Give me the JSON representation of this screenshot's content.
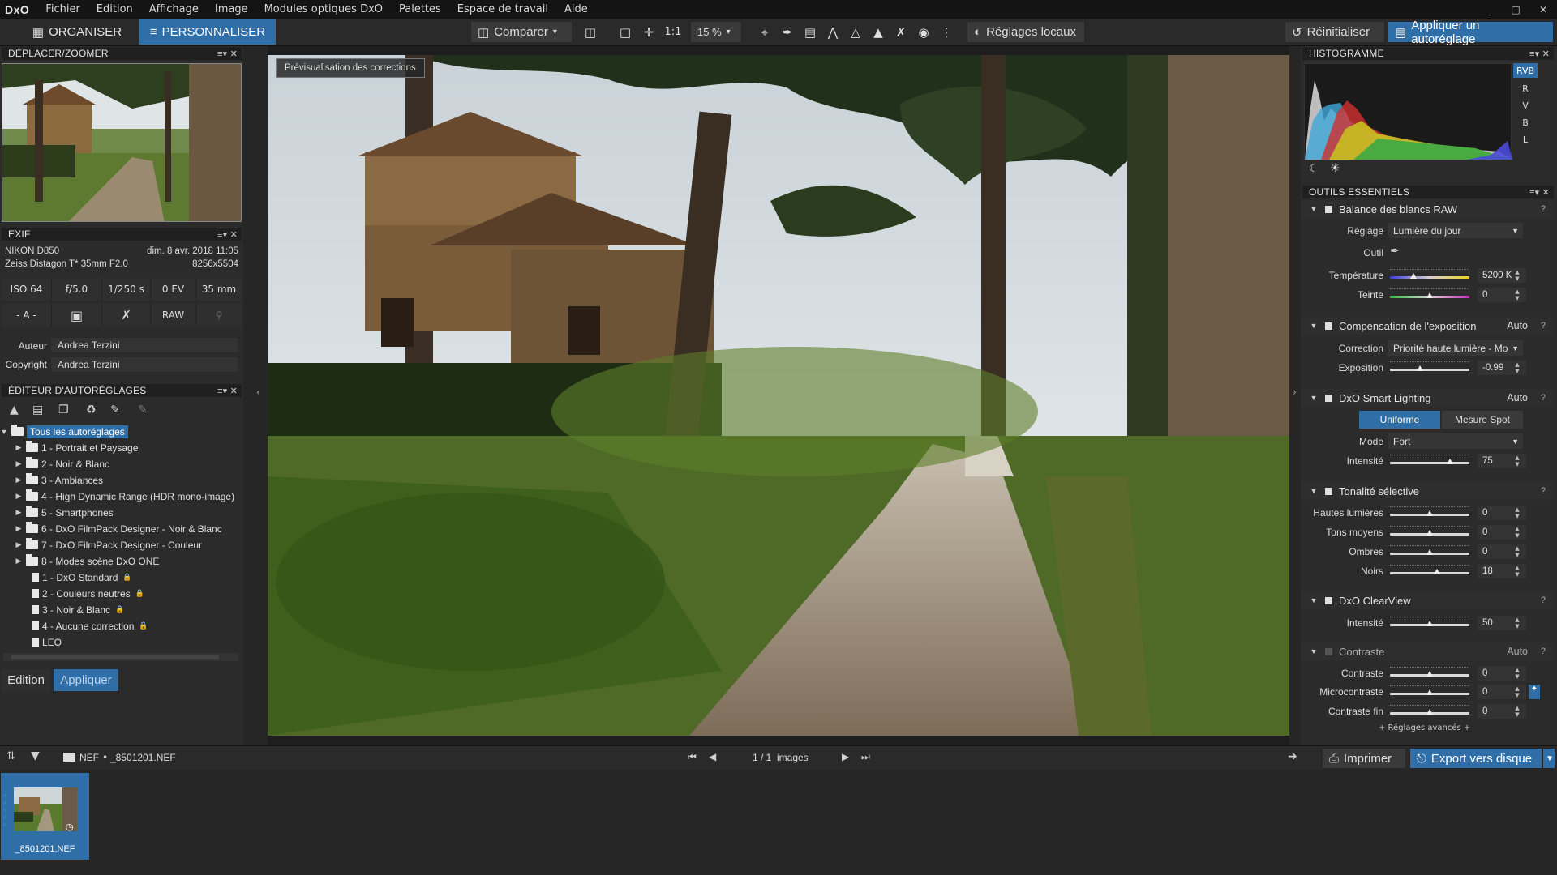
{
  "app": {
    "logo": "DxO"
  },
  "menu": [
    "Fichier",
    "Edition",
    "Affichage",
    "Image",
    "Modules optiques DxO",
    "Palettes",
    "Espace de travail",
    "Aide"
  ],
  "window_controls": [
    "_",
    "□",
    "✕"
  ],
  "toolbar": {
    "tab_organize": "ORGANISER",
    "tab_customize": "PERSONNALISER",
    "compare": "Comparer",
    "one_to_one": "1:1",
    "zoom": "15 %",
    "local_adjust": "Réglages locaux",
    "reset": "Réinitialiser",
    "apply_preset": "Appliquer un autoréglage"
  },
  "panels": {
    "move_zoom": "DÉPLACER/ZOOMER",
    "exif": "EXIF",
    "preset_editor": "ÉDITEUR D'AUTORÉGLAGES",
    "histogram": "HISTOGRAMME",
    "essential_tools": "OUTILS ESSENTIELS"
  },
  "panel_controls": "≡▾ ✕",
  "exif": {
    "camera": "NIKON D850",
    "date": "dim. 8 avr. 2018 11:05",
    "lens": "Zeiss Distagon T* 35mm F2.0",
    "dimensions": "8256x5504",
    "iso": "ISO 64",
    "aperture": "f/5.0",
    "shutter": "1/250 s",
    "ev": "0 EV",
    "focal": "35 mm",
    "mode": "- A -",
    "raw": "RAW",
    "author_label": "Auteur",
    "author": "Andrea Terzini",
    "copyright_label": "Copyright",
    "copyright": "Andrea Terzini"
  },
  "tree": [
    {
      "label": "Tous les autoréglages",
      "type": "root"
    },
    {
      "label": "1 - Portrait et Paysage",
      "type": "folder"
    },
    {
      "label": "2 - Noir & Blanc",
      "type": "folder"
    },
    {
      "label": "3 - Ambiances",
      "type": "folder"
    },
    {
      "label": "4 - High Dynamic Range (HDR mono-image)",
      "type": "folder"
    },
    {
      "label": "5 - Smartphones",
      "type": "folder"
    },
    {
      "label": "6 - DxO FilmPack Designer - Noir & Blanc",
      "type": "folder"
    },
    {
      "label": "7 - DxO FilmPack Designer - Couleur",
      "type": "folder"
    },
    {
      "label": "8 - Modes scène DxO ONE",
      "type": "folder"
    },
    {
      "label": "1 - DxO Standard",
      "type": "preset",
      "locked": true
    },
    {
      "label": "2 - Couleurs neutres",
      "type": "preset",
      "locked": true
    },
    {
      "label": "3 - Noir & Blanc",
      "type": "preset",
      "locked": true
    },
    {
      "label": "4 - Aucune correction",
      "type": "preset",
      "locked": true
    },
    {
      "label": "LEO",
      "type": "preset",
      "locked": false
    }
  ],
  "left_buttons": {
    "edit": "Edition",
    "apply": "Appliquer"
  },
  "viewer": {
    "preview_tag": "Prévisualisation des corrections"
  },
  "histogram": {
    "channels": [
      "RVB",
      "R",
      "V",
      "B",
      "L"
    ],
    "selected": "RVB"
  },
  "tools": {
    "white_balance": {
      "title": "Balance des blancs RAW",
      "setting_label": "Réglage",
      "setting": "Lumière du jour",
      "tool_label": "Outil",
      "temp_label": "Température",
      "temp": "5200 K",
      "temp_pos": 0.3,
      "tint_label": "Teinte",
      "tint": "0",
      "tint_pos": 0.5
    },
    "exposure": {
      "title": "Compensation de l'exposition",
      "auto": "Auto",
      "correction_label": "Correction",
      "correction": "Priorité haute lumière - Mo",
      "exposure_label": "Exposition",
      "exposure": "-0.99",
      "exposure_pos": 0.38
    },
    "smart_lighting": {
      "title": "DxO Smart Lighting",
      "auto": "Auto",
      "seg_uniform": "Uniforme",
      "seg_spot": "Mesure Spot",
      "mode_label": "Mode",
      "mode": "Fort",
      "intensity_label": "Intensité",
      "intensity": "75",
      "intensity_pos": 0.75
    },
    "selective_tone": {
      "title": "Tonalité sélective",
      "highlights_label": "Hautes lumières",
      "highlights": "0",
      "midtones_label": "Tons moyens",
      "midtones": "0",
      "shadows_label": "Ombres",
      "shadows": "0",
      "blacks_label": "Noirs",
      "blacks": "18",
      "blacks_pos": 0.59
    },
    "clearview": {
      "title": "DxO ClearView",
      "intensity_label": "Intensité",
      "intensity": "50",
      "intensity_pos": 0.5
    },
    "contrast": {
      "title": "Contraste",
      "auto": "Auto",
      "contrast_label": "Contraste",
      "contrast": "0",
      "micro_label": "Microcontraste",
      "micro": "0",
      "fine_label": "Contraste fin",
      "fine": "0",
      "advanced": "+ Réglages avancés +"
    }
  },
  "bottombar": {
    "format": "NEF",
    "file": "_8501201.NEF",
    "counter": "1 / 1",
    "images_label": "images",
    "print": "Imprimer",
    "export": "Export vers disque"
  },
  "filmstrip": {
    "name": "_8501201.NEF"
  }
}
